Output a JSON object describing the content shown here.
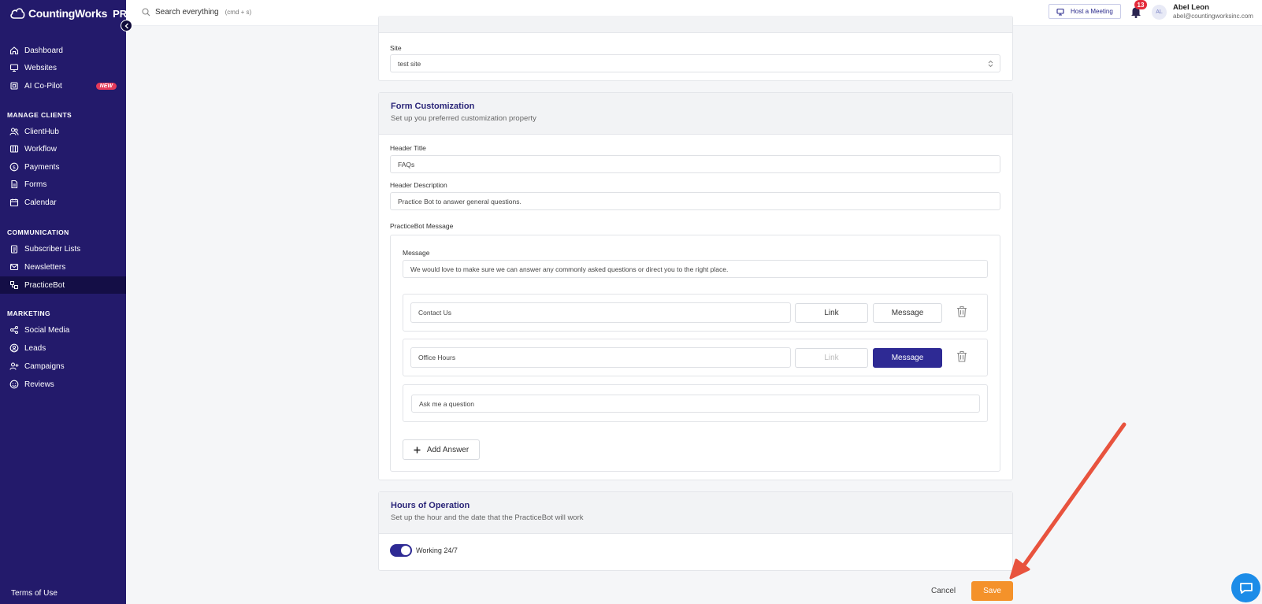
{
  "app": {
    "name": "CountingWorks",
    "tier": "PRO"
  },
  "sidebar": {
    "top_items": [
      {
        "label": "Dashboard",
        "icon": "home-icon"
      },
      {
        "label": "Websites",
        "icon": "monitor-icon"
      },
      {
        "label": "AI Co-Pilot",
        "icon": "cpu-icon",
        "badge": "NEW"
      }
    ],
    "sections": [
      {
        "title": "MANAGE CLIENTS",
        "items": [
          {
            "label": "ClientHub",
            "icon": "users-icon"
          },
          {
            "label": "Workflow",
            "icon": "columns-icon"
          },
          {
            "label": "Payments",
            "icon": "dollar-icon"
          },
          {
            "label": "Forms",
            "icon": "file-icon"
          },
          {
            "label": "Calendar",
            "icon": "calendar-icon"
          }
        ]
      },
      {
        "title": "COMMUNICATION",
        "items": [
          {
            "label": "Subscriber Lists",
            "icon": "clipboard-icon"
          },
          {
            "label": "Newsletters",
            "icon": "mail-icon"
          },
          {
            "label": "PracticeBot",
            "icon": "bot-icon",
            "active": true
          }
        ]
      },
      {
        "title": "MARKETING",
        "items": [
          {
            "label": "Social Media",
            "icon": "share-icon"
          },
          {
            "label": "Leads",
            "icon": "user-circle-icon"
          },
          {
            "label": "Campaigns",
            "icon": "user-plus-icon"
          },
          {
            "label": "Reviews",
            "icon": "smile-icon"
          }
        ]
      }
    ],
    "footer": "Terms of Use"
  },
  "topbar": {
    "search_placeholder": "Search everything",
    "search_hint": "(cmd + s)",
    "host_meeting": "Host a Meeting",
    "notifications": "13",
    "avatar_initials": "AL",
    "user_name": "Abel Leon",
    "user_email": "abel@countingworksinc.com"
  },
  "site_card": {
    "label": "Site",
    "value": "test site"
  },
  "form_customization": {
    "title": "Form Customization",
    "subtitle": "Set up you preferred customization property",
    "header_title_label": "Header Title",
    "header_title_value": "FAQs",
    "header_desc_label": "Header Description",
    "header_desc_value": "Practice Bot to answer general questions.",
    "bot_message_label": "PracticeBot Message",
    "message_label": "Message",
    "message_value": "We would love to make sure we can answer any commonly asked questions or direct you to the right place.",
    "answers": [
      {
        "value": "Contact Us",
        "link": "Link",
        "message": "Message",
        "selected": "link"
      },
      {
        "value": "Office Hours",
        "link": "Link",
        "message": "Message",
        "selected": "message"
      }
    ],
    "ask_value": "Ask me a question",
    "add_answer": "Add Answer"
  },
  "hours": {
    "title": "Hours of Operation",
    "subtitle": "Set up the hour and the date that the PracticeBot will work",
    "toggle_label": "Working 24/7",
    "toggle_on": true
  },
  "actions": {
    "cancel": "Cancel",
    "save": "Save"
  },
  "colors": {
    "sidebar": "#231a6b",
    "primary": "#2e2a94",
    "save": "#f4922a",
    "arrow": "#e8533e"
  }
}
